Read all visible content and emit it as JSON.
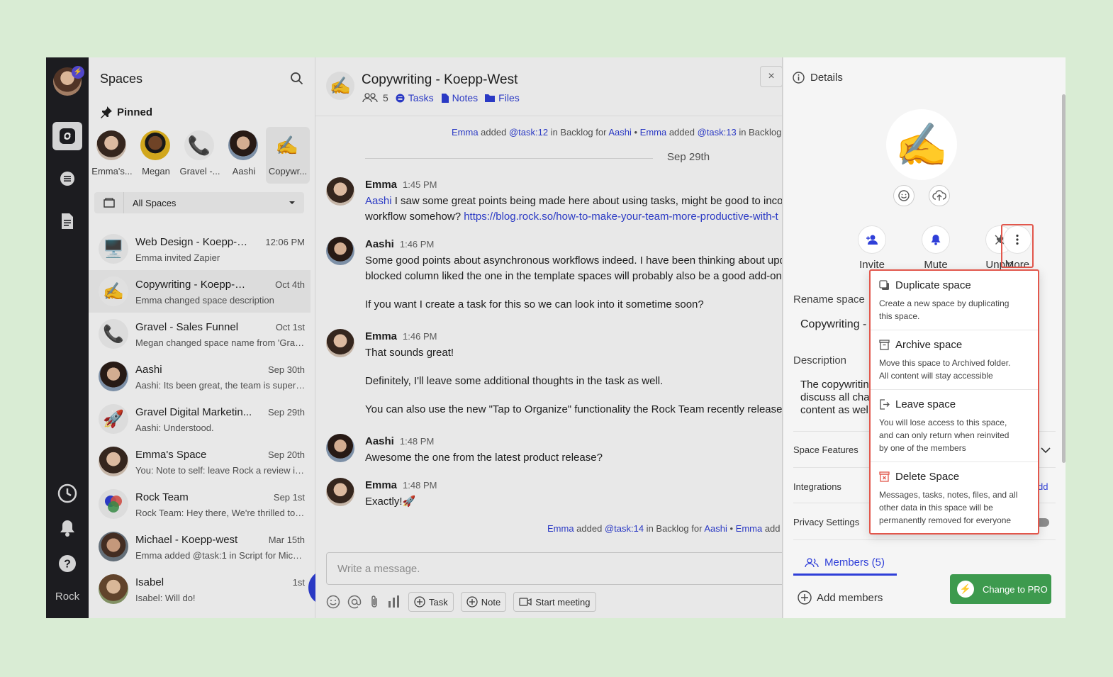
{
  "rail": {
    "app_label": "Rock",
    "badge": "⚡"
  },
  "spaces": {
    "title": "Spaces",
    "pinned_heading": "Pinned",
    "pinned": [
      {
        "label": "Emma's...",
        "icon": "person-avatar"
      },
      {
        "label": "Megan",
        "icon": "person-avatar"
      },
      {
        "label": "Gravel -...",
        "icon": "📞"
      },
      {
        "label": "Aashi",
        "icon": "person-avatar"
      },
      {
        "label": "Copywr...",
        "icon": "✍️"
      }
    ],
    "filter": "All Spaces",
    "items": [
      {
        "name": "Web Design - Koepp-W...",
        "time": "12:06 PM",
        "preview": "Emma invited Zapier",
        "icon": "🖥️"
      },
      {
        "name": "Copywriting - Koepp-W...",
        "time": "Oct 4th",
        "preview": "Emma changed space description",
        "icon": "✍️"
      },
      {
        "name": "Gravel - Sales Funnel",
        "time": "Oct 1st",
        "preview": "Megan changed space name from 'Grav...",
        "icon": "📞"
      },
      {
        "name": "Aashi",
        "time": "Sep 30th",
        "preview": "Aashi: Its been great, the team is super ...",
        "icon": "person-avatar"
      },
      {
        "name": "Gravel Digital Marketin...",
        "time": "Sep 29th",
        "preview": "Aashi: Understood.",
        "icon": "🚀"
      },
      {
        "name": "Emma's Space",
        "time": "Sep 20th",
        "preview": "You: Note to self: leave Rock a review in ...",
        "icon": "person-avatar"
      },
      {
        "name": "Rock Team",
        "time": "Sep 1st",
        "preview": "Rock Team: Hey there, We're thrilled to a...",
        "icon": "rock-logo"
      },
      {
        "name": "Michael - Koepp-west",
        "time": "Mar 15th",
        "preview": "Emma added @task:1 in Script for Mich...",
        "icon": "person-avatar"
      },
      {
        "name": "Isabel",
        "time": "1st",
        "preview": "Isabel: Will do!",
        "icon": "person-avatar"
      }
    ],
    "fab": "+"
  },
  "chat": {
    "emoji": "✍️",
    "title": "Copywriting - Koepp-West",
    "members_count": "5",
    "tabs": {
      "tasks": "Tasks",
      "notes": "Notes",
      "files": "Files"
    },
    "close": "×",
    "sys_top": {
      "a": "Emma",
      "b": " added ",
      "c": "@task:12",
      "d": " in Backlog for ",
      "e": "Aashi",
      "f": " • ",
      "g": "Emma",
      "h": " added ",
      "i": "@task:13",
      "j": " in Backlog"
    },
    "date": "Sep 29th",
    "messages": [
      {
        "name": "Emma",
        "time": "1:45 PM",
        "l1_mention": "Aashi",
        "l1": " I saw some great points being made here about using tasks, might be good to inco",
        "l2": "workflow somehow? ",
        "l2_link": "https://blog.rock.so/how-to-make-your-team-more-productive-with-t"
      },
      {
        "name": "Aashi",
        "time": "1:46 PM",
        "l1": "Some good points about asynchronous workflows indeed. I have been thinking about upd",
        "l2": "blocked column liked the one in the template spaces will probably also be a good add-on.",
        "l3": "If you want I create a task for this so we can look into it sometime soon?"
      },
      {
        "name": "Emma",
        "time": "1:46 PM",
        "l1": "That sounds great!",
        "l2": "Definitely, I'll leave some additional thoughts in the task as well.",
        "l3": "You can also use the new \"Tap to Organize\" functionality the Rock Team recently released"
      },
      {
        "name": "Aashi",
        "time": "1:48 PM",
        "l1": "Awesome the one from the latest product release?"
      },
      {
        "name": "Emma",
        "time": "1:48 PM",
        "l1": "Exactly!🚀"
      }
    ],
    "sys_bottom": {
      "a": "Emma",
      "b": " added ",
      "c": "@task:14",
      "d": " in Backlog for ",
      "e": "Aashi",
      "f": " • ",
      "g": "Emma",
      "h": " add"
    },
    "composer_placeholder": "Write a message.",
    "toolbar": {
      "task": "Task",
      "note": "Note",
      "meeting": "Start meeting"
    }
  },
  "details": {
    "title": "Details",
    "emoji": "✍️",
    "actions": {
      "invite": "Invite",
      "mute": "Mute",
      "unpin": "Unpin",
      "more": "More"
    },
    "rename_label": "Rename space",
    "rename_value": "Copywriting -",
    "description_label": "Description",
    "description_lines": [
      "The copywritin",
      "discuss all cha",
      "content as wel"
    ],
    "space_features": "Space Features",
    "integrations": "Integrations",
    "integrations_add": "dd",
    "privacy": "Privacy Settings",
    "members_tab": "Members (5)",
    "add_members": "Add members",
    "pro_button": "Change to PRO"
  },
  "menu": {
    "items": [
      {
        "title": "Duplicate space",
        "desc": [
          "Create a new space by duplicating",
          "this space."
        ]
      },
      {
        "title": "Archive space",
        "desc": [
          "Move this space to Archived folder.",
          "All content will stay accessible"
        ]
      },
      {
        "title": "Leave space",
        "desc": [
          "You will lose access to this space,",
          "and can only return when reinvited",
          "by one of the members"
        ]
      },
      {
        "title": "Delete Space",
        "desc": [
          "Messages, tasks, notes, files, and all",
          "other data in this space will be",
          "permanently removed for everyone"
        ]
      }
    ]
  },
  "colors": {
    "accent": "#2f3fd8",
    "highlight": "#e2574c",
    "pro": "#3d9a4e",
    "rail": "#1f1f24"
  }
}
